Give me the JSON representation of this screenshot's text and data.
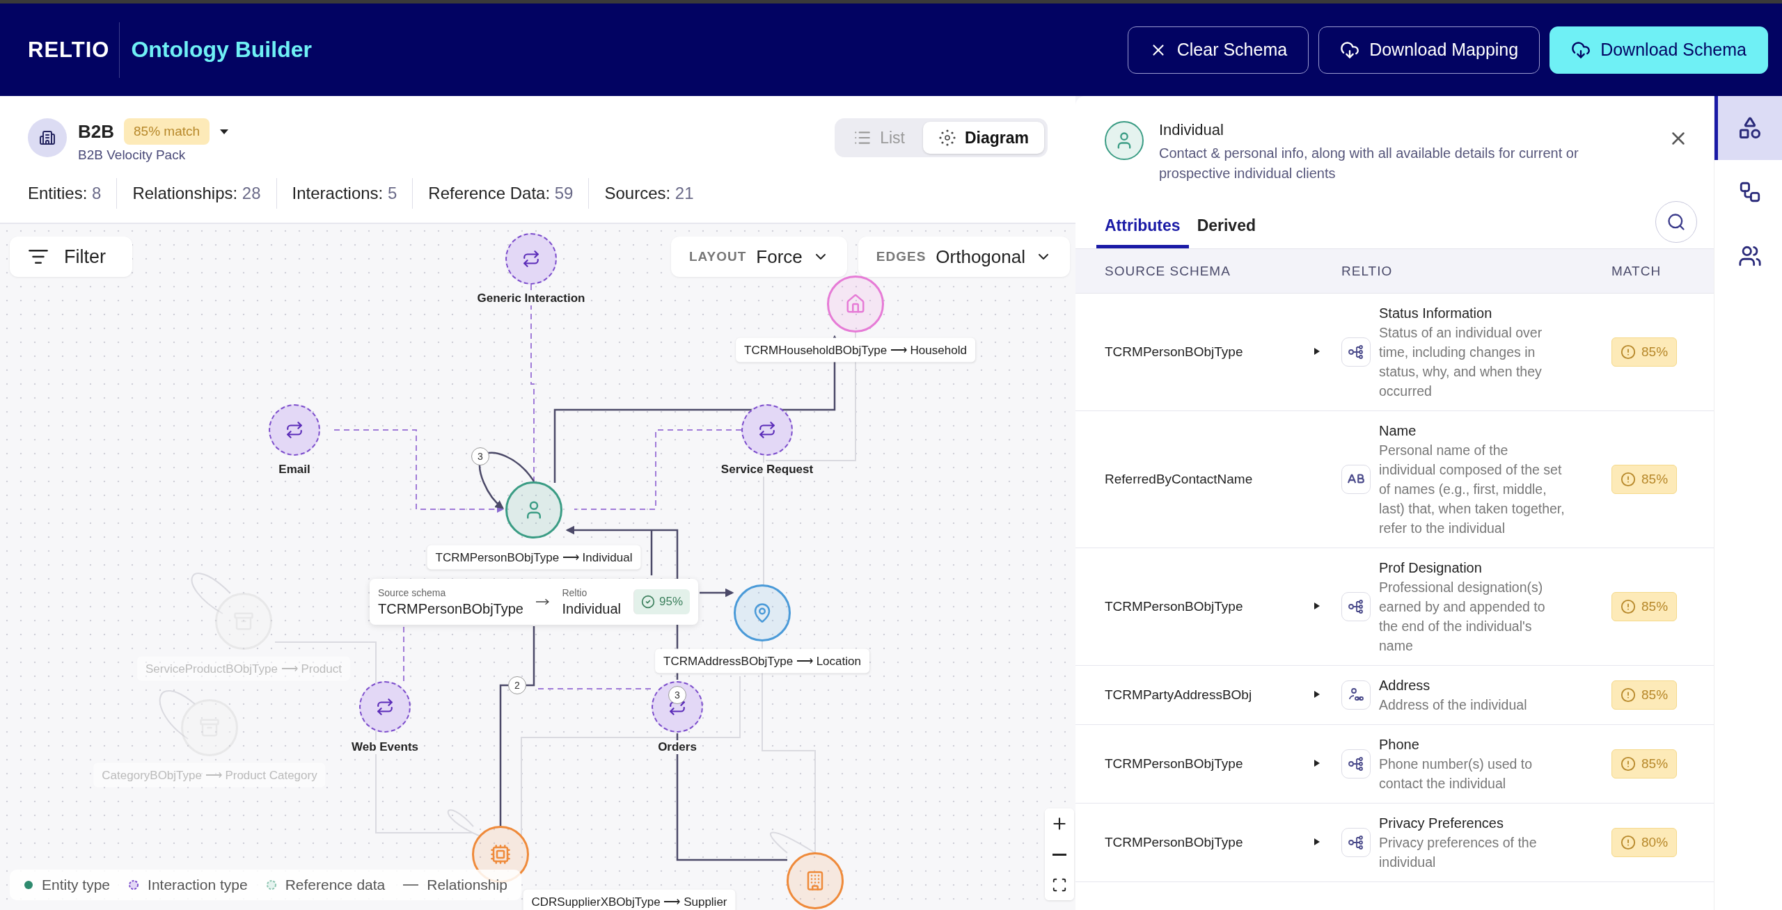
{
  "app": {
    "logo": "RELTIO",
    "title": "Ontology Builder"
  },
  "header_buttons": [
    {
      "label": "Clear Schema",
      "kind": "clear",
      "primary": false
    },
    {
      "label": "Download Mapping",
      "kind": "download",
      "primary": false
    },
    {
      "label": "Download Schema",
      "kind": "download",
      "primary": true
    }
  ],
  "pack": {
    "name": "B2B",
    "match": "85% match",
    "subtitle": "B2B Velocity Pack"
  },
  "view_toggle": [
    {
      "label": "List",
      "kind": "list",
      "selected": false
    },
    {
      "label": "Diagram",
      "kind": "diagram",
      "selected": true
    }
  ],
  "stats": [
    {
      "label": "Entities:",
      "value": "8"
    },
    {
      "label": "Relationships:",
      "value": "28"
    },
    {
      "label": "Interactions:",
      "value": "5"
    },
    {
      "label": "Reference Data:",
      "value": "59"
    },
    {
      "label": "Sources:",
      "value": "21"
    }
  ],
  "diagram": {
    "filter": "Filter",
    "layout": {
      "label": "LAYOUT",
      "value": "Force"
    },
    "edges": {
      "label": "EDGES",
      "value": "Orthogonal"
    },
    "nodes": [
      {
        "kind": "interaction",
        "label": "Generic Interaction"
      },
      {
        "kind": "entity",
        "label": "TCRMHouseholdBObjType ⟶ Household",
        "color": "#e67bd6",
        "faded": false
      },
      {
        "kind": "interaction",
        "label": "Email"
      },
      {
        "kind": "interaction",
        "label": "Service Request"
      },
      {
        "kind": "entity",
        "label": "TCRMPersonBObjType ⟶ Individual",
        "color": "#3a9c84",
        "faded": false
      },
      {
        "kind": "entity",
        "label": "TCRMAddressBObjType ⟶ Location",
        "color": "#4a9ad8",
        "faded": false
      },
      {
        "kind": "entity",
        "label": "ServiceProductBObjType ⟶ Product",
        "color": "#d6d6d6",
        "faded": true
      },
      {
        "kind": "interaction",
        "label": "Web Events"
      },
      {
        "kind": "interaction",
        "label": "Orders"
      },
      {
        "kind": "entity",
        "label": "CategoryBObjType ⟶ Product Category",
        "color": "#d6d6d6",
        "faded": true
      },
      {
        "kind": "entity",
        "label": "CDRSupplierXBObjType ⟶ Supplier",
        "color": "#ef8a3a",
        "faded": false
      },
      {
        "kind": "entity",
        "color": "#ef8a3a",
        "faded": false
      }
    ],
    "edge_badges": [
      "3",
      "2",
      "3"
    ],
    "tooltip": {
      "source_label": "Source schema",
      "source": "TCRMPersonBObjType",
      "target_label": "Reltio",
      "target": "Individual",
      "match": "95%"
    },
    "legend": [
      {
        "kind": "entity",
        "label": "Entity type"
      },
      {
        "kind": "interaction",
        "label": "Interaction type"
      },
      {
        "kind": "reference",
        "label": "Reference data"
      },
      {
        "kind": "relationship",
        "label": "Relationship"
      }
    ]
  },
  "detail": {
    "title": "Individual",
    "description": "Contact & personal info, along with all available details for current or prospective individual clients",
    "tabs": [
      {
        "label": "Attributes",
        "selected": true
      },
      {
        "label": "Derived",
        "selected": false
      }
    ],
    "columns": [
      "SOURCE SCHEMA",
      "RELTIO",
      "MATCH"
    ],
    "rows": [
      {
        "source": "TCRMPersonBObjType",
        "expandable": true,
        "kind": "nested",
        "name": "Status Information",
        "description": "Status of an individual over time, including changes in status, why, and when they occurred",
        "match": "85%"
      },
      {
        "source": "ReferredByContactName",
        "expandable": false,
        "kind": "text",
        "name": "Name",
        "description": "Personal name of the individual composed of the set of names (e.g., first, middle, last) that, when taken together, refer to the individual",
        "match": "85%"
      },
      {
        "source": "TCRMPersonBObjType",
        "expandable": true,
        "kind": "nested",
        "name": "Prof Designation",
        "description": "Professional designation(s) earned by and appended to the end of the individual's name",
        "match": "85%"
      },
      {
        "source": "TCRMPartyAddressBObj",
        "expandable": true,
        "kind": "reference",
        "name": "Address",
        "description": "Address of the individual",
        "match": "85%"
      },
      {
        "source": "TCRMPersonBObjType",
        "expandable": true,
        "kind": "nested",
        "name": "Phone",
        "description": "Phone number(s) used to contact the individual",
        "match": "85%"
      },
      {
        "source": "TCRMPersonBObjType",
        "expandable": true,
        "kind": "nested",
        "name": "Privacy Preferences",
        "description": "Privacy preferences of the individual",
        "match": "80%"
      }
    ]
  },
  "rail": [
    {
      "kind": "schema",
      "selected": true
    },
    {
      "kind": "mapping",
      "selected": false
    },
    {
      "kind": "users",
      "selected": false
    }
  ]
}
